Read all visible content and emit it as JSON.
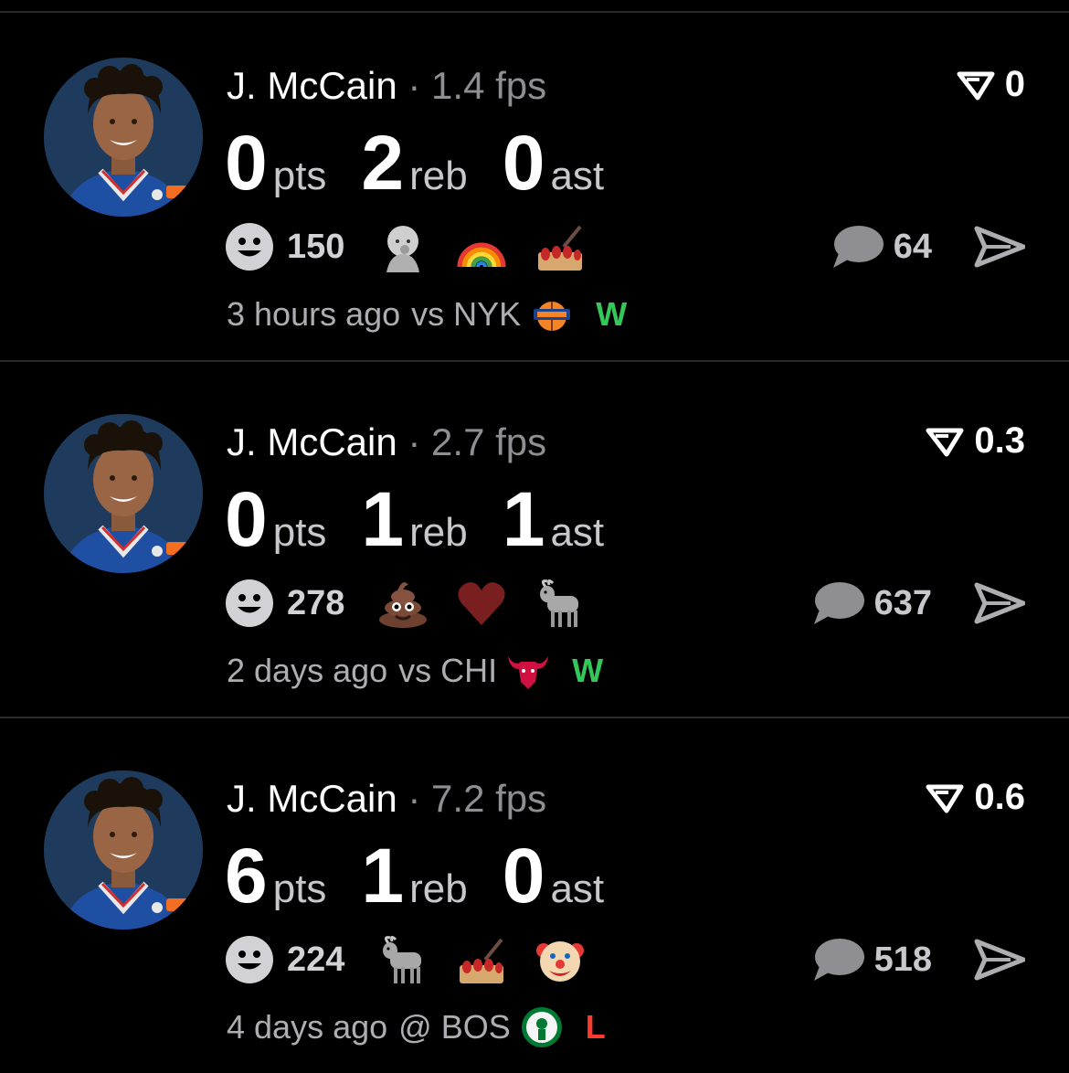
{
  "colors": {
    "background": "#000000",
    "divider": "#2a2a2c",
    "muted": "#8e8e93",
    "win": "#34c759",
    "loss": "#ff3b30"
  },
  "posts": [
    {
      "player": "J. McCain",
      "sep": "·",
      "fps": "1.4 fps",
      "score": "0",
      "stats": [
        {
          "value": "0",
          "unit": "pts"
        },
        {
          "value": "2",
          "unit": "reb"
        },
        {
          "value": "0",
          "unit": "ast"
        }
      ],
      "reaction_count": "150",
      "emojis": [
        "baby-emoji",
        "rainbow-emoji",
        "nail-polish-emoji"
      ],
      "comment_count": "64",
      "time": "3 hours ago",
      "opponent": "vs NYK",
      "result": "W"
    },
    {
      "player": "J. McCain",
      "sep": "·",
      "fps": "2.7 fps",
      "score": "0.3",
      "stats": [
        {
          "value": "0",
          "unit": "pts"
        },
        {
          "value": "1",
          "unit": "reb"
        },
        {
          "value": "1",
          "unit": "ast"
        }
      ],
      "reaction_count": "278",
      "emojis": [
        "poop-emoji",
        "heart-emoji",
        "goat-emoji"
      ],
      "comment_count": "637",
      "time": "2 days ago",
      "opponent": "vs CHI",
      "result": "W"
    },
    {
      "player": "J. McCain",
      "sep": "·",
      "fps": "7.2 fps",
      "score": "0.6",
      "stats": [
        {
          "value": "6",
          "unit": "pts"
        },
        {
          "value": "1",
          "unit": "reb"
        },
        {
          "value": "0",
          "unit": "ast"
        }
      ],
      "reaction_count": "224",
      "emojis": [
        "goat-emoji",
        "nail-polish-emoji",
        "clown-emoji"
      ],
      "comment_count": "518",
      "time": "4 days ago",
      "opponent": "@ BOS",
      "result": "L"
    }
  ]
}
